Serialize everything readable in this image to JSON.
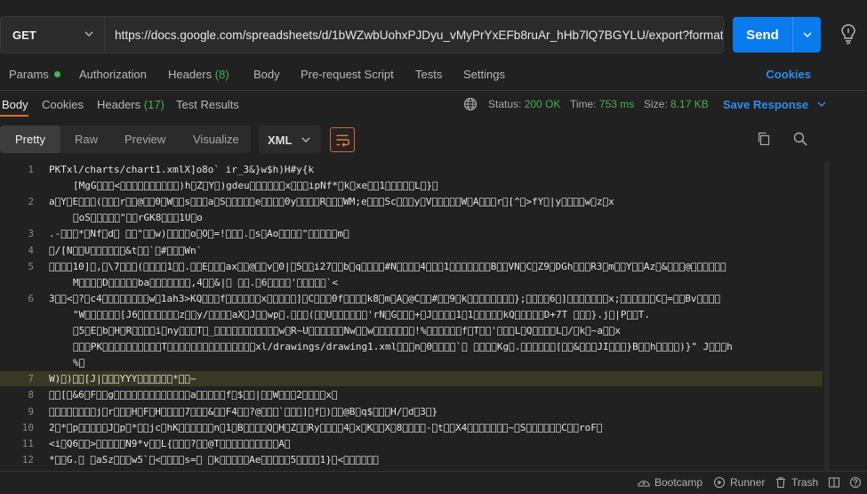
{
  "request": {
    "method": "GET",
    "url": "https://docs.google.com/spreadsheets/d/1bWZwbUohxPJDyu_vMyPrYxEFb8ruAr_hHb7lQ7BGYLU/export?format=xlsx",
    "send_label": "Send"
  },
  "request_tabs": {
    "params": "Params",
    "authorization": "Authorization",
    "headers": "Headers",
    "headers_count": "(8)",
    "body": "Body",
    "prerequest": "Pre-request Script",
    "tests": "Tests",
    "settings": "Settings",
    "cookies": "Cookies"
  },
  "response_tabs": {
    "body": "Body",
    "cookies": "Cookies",
    "headers": "Headers",
    "headers_count": "(17)",
    "test_results": "Test Results"
  },
  "response_meta": {
    "status_label": "Status:",
    "status_value": "200 OK",
    "time_label": "Time:",
    "time_value": "753 ms",
    "size_label": "Size:",
    "size_value": "8.17 KB",
    "save_response": "Save Response"
  },
  "format_bar": {
    "pretty": "Pretty",
    "raw": "Raw",
    "preview": "Preview",
    "visualize": "Visualize",
    "language": "XML"
  },
  "code_lines": [
    {
      "n": "1",
      "text": "PK\u0003\u0004\u0014\u0000\b\b\b\u0000T\u0000\u0000\u0000\u0000\u0000\u0000\u0000\u0000\u0000\u0000\u0000\u0000\u0000\u0000\u0000\u0000xl/charts/chart1.xml\u0000X]o\u00008\u0000\u0000\u0000\u0000\u0000\u0000\u0000o\u0000\u0000` \u0000\u0000ir_\u00003&\u0000}w\u0000$h\u0000\u0000\u0000\u0000)\u0000\u0000\u0000\u0000H\u0000\u0000#y\u0000\u0000\u0000\u0000\u0000{\u0000k\u0000\u0000\u0000\u0000"
    },
    {
      "n": "",
      "text": "[MgG\u0000\u0000\u0000<\u0000\u0000\u0000\u0000\u0000\u0000\u0000\u0000\u0000\u0000)h\u0000Z\u0000Y\u0000)gdeu\u0000\u0000\u0000\u0000\u0000\u0000x\u0000\u0000\u0000ipNf*\u0000k\u0000xe\u0000\u00001\u0000\u0000\u0000\u0000\u0000L\u0000}\u0000",
      "indent": true
    },
    {
      "n": "2",
      "text": "a\u0000Y\u0000E\u0000\u0000\u0000(\u0000\u0000\u0000r\u0000\u0000@\u0000\u00000\u0000W\u0000\u0000s\u0000\u0000\u0000a\u0000S\u0000\u0000\u0000\u0000\u0000e\u0000\u0000\u0000\u00000y\u0000\u0000\u0000\u0000R\u0000\u0000\u0000WM;e\u0000\u0000\u0000Sc\u0000\u0000\u0000y\u0000V\u0000\u0000\u0000\u0000\u0000W\u0000A\u0000\u0000\u0000r\u0000[^\u0000>fY\u0000|y\u0000\u0000\u0000\u0000w\u0000z\u0000x"
    },
    {
      "n": "",
      "text": "\u0000oS\u0000\u0000\u0000\u0000\u0000\"\u0000\u0000rGK8\u0000\u0000\u00001U\u0000o",
      "indent": true
    },
    {
      "n": "3",
      "text": ".-\u0000\u0000\u0000*\u0000Nf\u0000d\u0000 \u0000\u0000\"\u0000\u0000w)\u0000\u0000\u0000\u0000o\u0000O\u0000=!\u0000\u0000\u0000.\u0000s\u0000Ao\u0000\u0000\u0000\u0000\"\u0000\u0000\u0000\u0000\u0000m\u0000"
    },
    {
      "n": "4",
      "text": "\u0000/[N\u0000\u0000U\u0000\u0000\u0000\u0000\u0000\u0000&t\u0000\u0000`\u0000#\u0000\u0000\u0000Wn`"
    },
    {
      "n": "5",
      "text": "\u0000\u0000\u0000\u000010]\u0000,\u0000\\7\u0000\u0000\u0000(\u0000\u0000\u0000\u00001\u0000\u0000.\u0000\u0000E\u0000\u0000\u0000ax\u0000\u0000@\u0000\u0000v\u00000|\u00005\u0000\u0000i27\u0000\u0000b\u0000q\u0000\u0000\u0000\u0000#N\u0000\u0000\u0000\u00004\u0000\u0000\u00001\u0000\u0000\u0000\u0000\u0000\u0000\u0000B\u0000\u0000VN\u0000C\u0000Z9\u0000DGh\u0000\u0000\u0000R3\u0000m\u0000\u0000Y\u0000\u0000Az\u0000&\u0000\u0000\u0000@\u0000\u0000\u0000\u0000\u0000\u0000"
    },
    {
      "n": "",
      "text": "M\u0000\u0000\u0000\u0000D\u0000\u0000\u0000\u0000\u0000ba\u0000\u0000\u0000\u0000\u0000\u0000\u0000,4\u0000\u0000&|\u0000 \u0000\u0000.\u00006\u0000\u0000\u0000\u0000'\u0000\u0000\u0000\u0000\u0000`<",
      "indent": true
    },
    {
      "n": "6",
      "text": "3\u0000\u0000<\u0000?\u0000c4\u0000\u0000\u0000\u0000\u0000\u0000\u0000\u0000w\u00001ah3>KQ\u0000\u0000\u0000f\u0000\u0000\u0000\u0000\u0000\u0000x\u0000\u0000\u0000\u0000\u0000]\u0000C\u0000\u0000\u00000f\u0000\u0000\u0000\u0000k8\u0000m\u0000A\u0000@C\u0000\u0000#\u0000\u00009\u0000k\u0000\u0000\u0000\u0000\u0000\u0000\u0000\u0000};\u0000\u0000\u0000\u00006\u0000]\u0000\u0000\u0000\u0000\u0000\u0000\u0000x;\u0000\u0000\u0000\u0000\u0000\u0000C\u0000=\u0000\u0000Bv\u0000\u0000\u0000\u0000"
    },
    {
      "n": "",
      "text": "\"W\u0000\u0000\u0000\u0000\u0000\u0000[J6\u0000\u0000\u0000\u0000\u0000\u0000\u0000z\u0000\u0000y/\u0000\u0000\u0000\u0000aX\u0000J\u0000\u0000wp\u0000.\u0000\u0000\u0000(\u0000\u0000U\u0000\u0000\u0000\u0000\u0000\u0000'rN\u0000G\u0000\u0000\u0000+\u0000J\u0000\u0000\u0000\u00001\u00001\u0000\u0000\u0000\u0000\u0000kQ\u0000\u0000\u0000\u0000\u0000D+7T \u0000\u0000\u0000}.j\u0000|P\u0000\u0000T.",
      "indent": true
    },
    {
      "n": "",
      "text": "\u00005\u0000E\u0000b\u0000H\u0000R\u0000\u0000\u0000\u0000i\u0000ny\u0000\u0000\u0000T\u0000_\u0000\u0000\u0000\u0000\u0000\u0000\u0000\u0000\u0000\u0000\u0000w\u0000R~U\u0000\u0000\u0000\u0000\u0000\u0000Nw\u0000\u0000w\u0000\u0000\u0000\u0000\u0000\u0000\u0000!%\u0000\u0000\u0000\u0000\u0000\u0000f\u0000T\u0000\u0000'\u0000\u0000\u0000L\u0000Q\u0000\u0000\u0000\u0000L\u0000/\u0000k\u0000~a\u0000\u0000x",
      "indent": true
    },
    {
      "n": "",
      "text": "\u0000\u0000\u0000PK\u0000\u0000\u0000\u0000\u0000\u0000\u0000\u0000\u0000\u0000T\u0000\u0000\u0000\u0000\u0000\u0000\u0000\u0000\u0000\u0000\u0000\u0000\u0000\u0000\u0000xl/drawings/drawing1.xml\u0000\u0000\u0000n\u00000\u0000\u0000\u0000\u0000`\u0000 \u0000\u0000\u0000\u0000Kg\u0000.\u0000\u0000\u0000\u0000\u0000\u0000[\u0000\u0000&\u0000\u0000\u0000JI\u0000\u0000\u0000}B\u0000\u0000h\u0000\u0000\u0000\u0000)}\"    J\u0000\u0000\u0000h",
      "indent": true
    },
    {
      "n": "",
      "text": "%\u0000",
      "indent": true
    },
    {
      "n": "7",
      "text": "W)\u0000)\u0000\u0000[J|\u0000\u0000\u0000YYY\u0000\u0000\u0000\u0000\u0000\u0000*\u0000\u0000~",
      "highlight": true
    },
    {
      "n": "8",
      "text": "\u0000\u0000[\u0000&6\u0000F\u0000\u0000g\u0000\u0000\u0000\u0000\u0000\u0000\u0000\u0000\u0000\u0000\u0000\u0000\u0000a\u0000\u0000\u0000\u0000\u0000f\u0000$\u0000\u0000|\u0000\u0000W\u0000\u0000\u00002\u0000\u0000\u0000\u0000x\u0000"
    },
    {
      "n": "9",
      "text": "\u0000\u0000\u0000\u0000\u0000\u0000\u0000\u0000j\u0000r\u0000\u0000\u0000H\u0000F\u0000H\u0000\u0000\u0000\u00007\u0000\u0000\u0000&\u0000\u0000F4\u0000\u0000?@\u0000\u0000\u0000`\u0000\u0000\u0000]\u0000f\u0000)\u0000\u0000@B\u0000q$\u0000\u0000\u0000H/\u0000d\u00003\u0000}"
    },
    {
      "n": "10",
      "text": "2\u0000*\u0000p\u0000\u0000\u0000\u0000\u0000J\u0000p\u0000*\u0000\u0000jc\u0000hK\u0000\u0000\u0000\u0000\u0000\u0000n\u00001\u0000B\u0000\u0000\u0000\u0000Q\u0000H\u0000Z\u0000\u0000Ry\u0000\u0000\u0000\u00004\u0000x\u0000K\u0000\u0000X\u00008\u0000\u0000\u0000\u0000-\u0000t\u0000\u0000X4\u0000\u0000\u0000\u0000\u0000\u0000\u0000~\u0000S\u0000\u0000\u0000\u0000\u0000\u0000C\u0000\u0000roF\u0000"
    },
    {
      "n": "11",
      "text": "<i\u0000Q6\u0000\u0000>\u0000\u0000\u0000\u0000\u0000N9*v\u0000\u0000L{\u0000\u0000\u0000?\u0000\u0000@T\u0000\u0000\u0000\u0000\u0000\u0000\u0000\u0000\u0000\u0000A\u0000"
    },
    {
      "n": "12",
      "text": "*\u0000\u0000G.\u0000 \u0000aSz\u0000\u0000\u0000w5`\u0000<\u0000\u0000\u0000\u0000s=\u0000 \u0000k\u0000\u0000\u0000\u0000\u0000Ae\u0000\u0000\u0000\u0000\u00005\u0000\u0000\u0000\u00001}\u0000<\u0000\u0000\u0000\u0000\u0000\u0000"
    }
  ],
  "status_bar": {
    "bootcamp": "Bootcamp",
    "runner": "Runner",
    "trash": "Trash"
  },
  "colors": {
    "accent": "#097bed",
    "link": "#2f8cf0",
    "success": "#47b24a",
    "tab_underline": "#e06a3a"
  }
}
